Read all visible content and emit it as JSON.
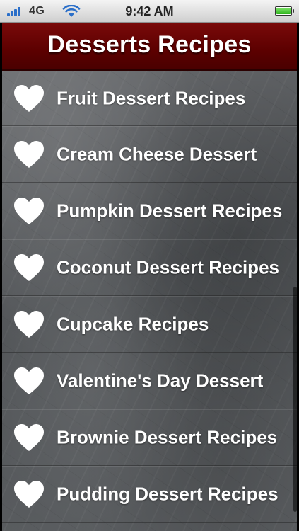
{
  "status_bar": {
    "carrier": "4G",
    "time": "9:42 AM",
    "icons": [
      "signal-icon",
      "wifi-icon",
      "battery-icon"
    ],
    "battery_level": 1.0
  },
  "header": {
    "title": "Desserts Recipes",
    "color": "#5c0000"
  },
  "list": {
    "item_icon": "heart-icon",
    "items": [
      {
        "label": "Fruit Dessert Recipes"
      },
      {
        "label": "Cream Cheese Dessert"
      },
      {
        "label": "Pumpkin Dessert Recipes"
      },
      {
        "label": "Coconut Dessert Recipes"
      },
      {
        "label": "Cupcake Recipes"
      },
      {
        "label": "Valentine's Day Dessert"
      },
      {
        "label": "Brownie Dessert Recipes"
      },
      {
        "label": "Pudding Dessert Recipes"
      }
    ]
  }
}
